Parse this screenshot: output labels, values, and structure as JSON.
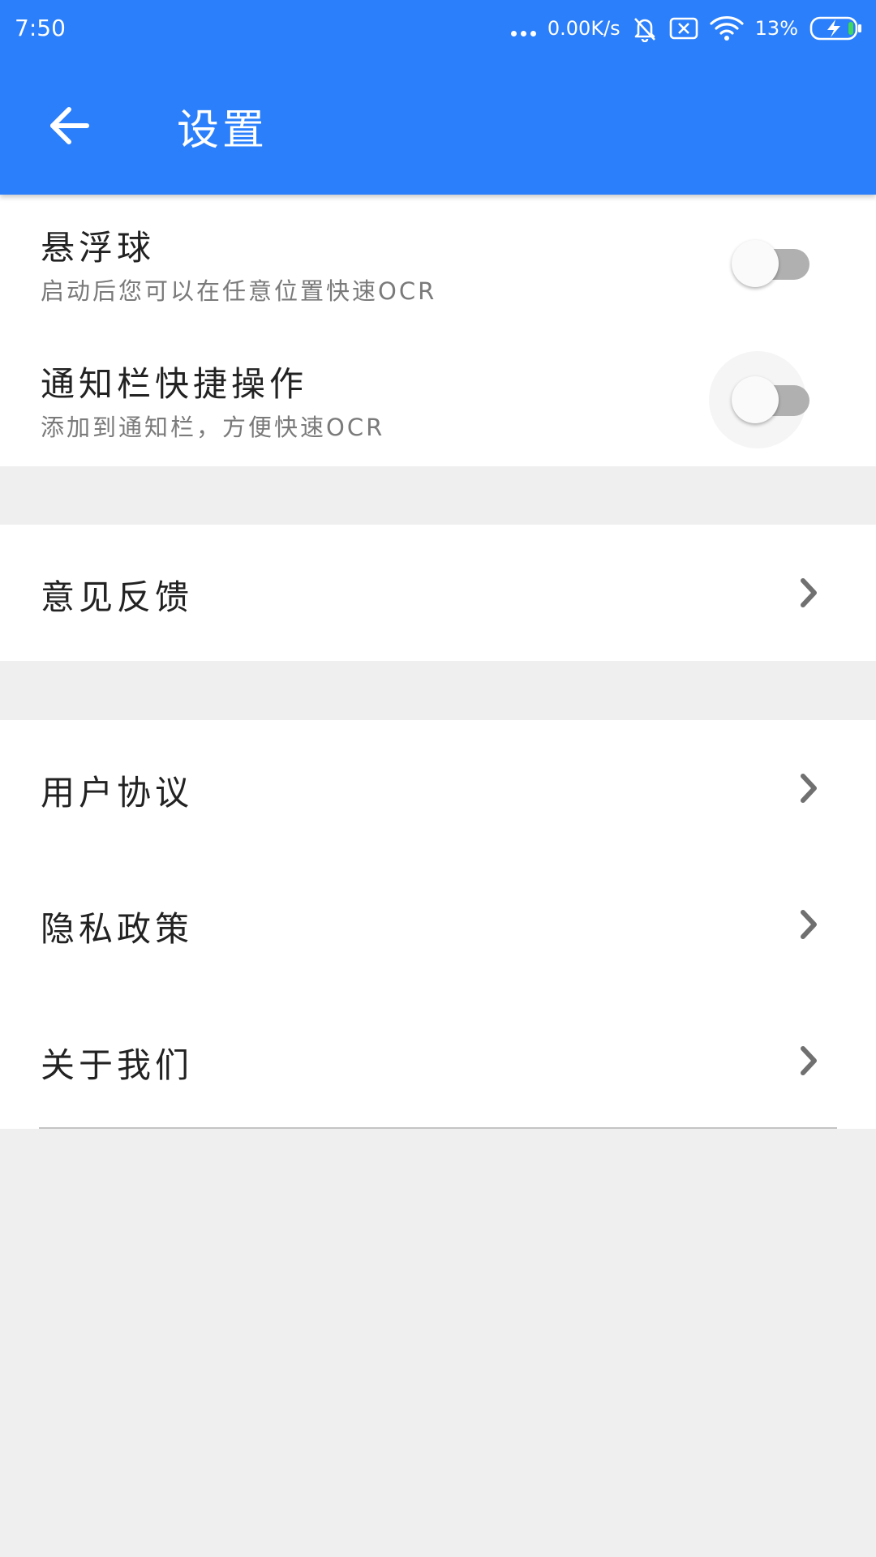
{
  "status_bar": {
    "time": "7:50",
    "network_speed": "0.00K/s",
    "battery": "13%",
    "icons": [
      "dots-icon",
      "bell-muted-icon",
      "no-sim-icon",
      "wifi-icon",
      "battery-charging-icon"
    ]
  },
  "toolbar": {
    "back_icon": "arrow-left-icon",
    "title": "设置"
  },
  "settings": {
    "floating_ball": {
      "title": "悬浮球",
      "subtitle": "启动后您可以在任意位置快速OCR",
      "enabled": false
    },
    "notification_shortcut": {
      "title": "通知栏快捷操作",
      "subtitle": "添加到通知栏，方便快速OCR",
      "enabled": false
    }
  },
  "menu": {
    "feedback": "意见反馈",
    "user_agreement": "用户协议",
    "privacy_policy": "隐私政策",
    "about_us": "关于我们"
  },
  "colors": {
    "primary": "#2b7ffa",
    "background": "#efefef",
    "switch_off_track": "#b0b0b0",
    "chevron": "#707070"
  }
}
